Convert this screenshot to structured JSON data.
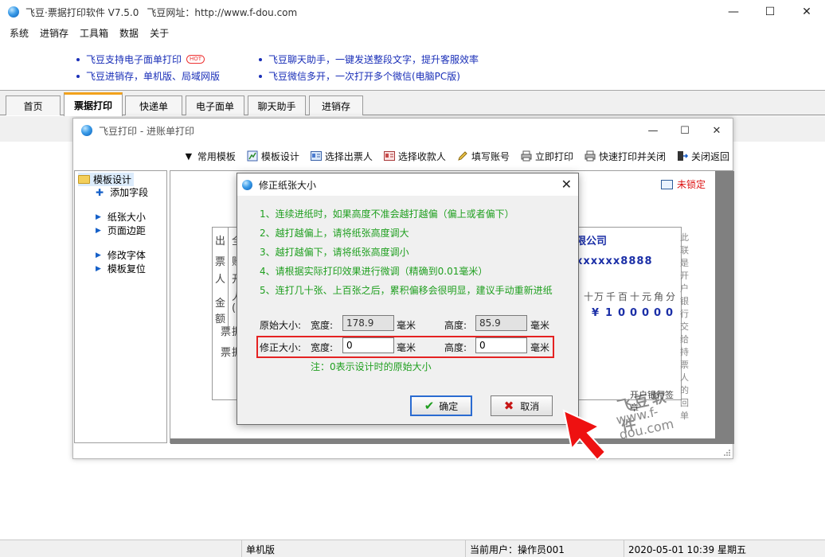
{
  "window": {
    "title": "飞豆·票据打印软件 V7.5.0",
    "url_label": "飞豆网址：http://www.f-dou.com",
    "minimize": "—",
    "maximize": "☐",
    "close": "✕"
  },
  "menu": {
    "items": [
      "系统",
      "进销存",
      "工具箱",
      "数据",
      "关于"
    ]
  },
  "banner": {
    "links": [
      "飞豆支持电子面单打印",
      "飞豆聊天助手，一键发送整段文字，提升客服效率",
      "飞豆进销存，单机版、局域网版",
      "飞豆微信多开，一次打开多个微信(电脑PC版)"
    ],
    "hot_badge": "HOT"
  },
  "tabs": [
    {
      "label": "首页",
      "active": false
    },
    {
      "label": "票据打印",
      "active": true
    },
    {
      "label": "快递单",
      "active": false
    },
    {
      "label": "电子面单",
      "active": false
    },
    {
      "label": "聊天助手",
      "active": false
    },
    {
      "label": "进销存",
      "active": false
    }
  ],
  "child_window": {
    "title": "飞豆打印 - 进账单打印",
    "toolbar": [
      {
        "label": "常用模板",
        "icon": "caret-down-icon"
      },
      {
        "label": "模板设计",
        "icon": "chart-icon"
      },
      {
        "label": "选择出票人",
        "icon": "card-icon"
      },
      {
        "label": "选择收款人",
        "icon": "card-icon"
      },
      {
        "label": "填写账号",
        "icon": "pencil-icon"
      },
      {
        "label": "立即打印",
        "icon": "printer-icon"
      },
      {
        "label": "快速打印并关闭",
        "icon": "printer-icon"
      },
      {
        "label": "关闭返回",
        "icon": "exit-icon"
      }
    ],
    "tree": {
      "root": "模板设计",
      "items": [
        "添加字段",
        "纸张大小",
        "页面边距",
        "修改字体",
        "模板复位"
      ]
    },
    "lock_status": "未锁定",
    "invoice": {
      "company": "限公司",
      "account": "xxxxxx8888",
      "amount_heads": [
        "十",
        "万",
        "千",
        "百",
        "十",
        "元",
        "角",
        "分"
      ],
      "amount_values": [
        "¥",
        "1",
        "0",
        "0",
        "0",
        "0",
        "0"
      ],
      "stamp": "开户银行签章",
      "side_note": "此联是开户银行交给持票人的回单",
      "left_chars": [
        "出",
        "全",
        "票",
        "账",
        "人",
        "开",
        "金",
        "人",
        "额",
        "(",
        "票",
        "据",
        "票",
        "据"
      ],
      "watermark_cn": "飞豆软件",
      "watermark_url": "www.f-dou.com"
    }
  },
  "dialog": {
    "title": "修正纸张大小",
    "instructions": [
      "1、连续进纸时，如果高度不准会越打越偏（偏上或者偏下）",
      "2、越打越偏上，请将纸张高度调大",
      "3、越打越偏下，请将纸张高度调小",
      "4、请根据实际打印效果进行微调（精确到0.01毫米）",
      "5、连打几十张、上百张之后，累积偏移会很明显，建议手动重新进纸"
    ],
    "original": {
      "label": "原始大小:",
      "width_label": "宽度:",
      "width": "178.9",
      "height_label": "高度:",
      "height": "85.9",
      "unit": "毫米"
    },
    "corrected": {
      "label": "修正大小:",
      "width_label": "宽度:",
      "width": "0",
      "height_label": "高度:",
      "height": "0",
      "unit": "毫米"
    },
    "note": "注：0表示设计时的原始大小",
    "ok": "确定",
    "cancel": "取消"
  },
  "status": {
    "mode": "单机版",
    "user": "当前用户：操作员001",
    "datetime": "2020-05-01 10:39 星期五"
  },
  "colors": {
    "accent_tab": "#f2a21b",
    "link": "#1a2fb8",
    "instruction": "#1f9f1f",
    "highlight": "#e52222"
  }
}
